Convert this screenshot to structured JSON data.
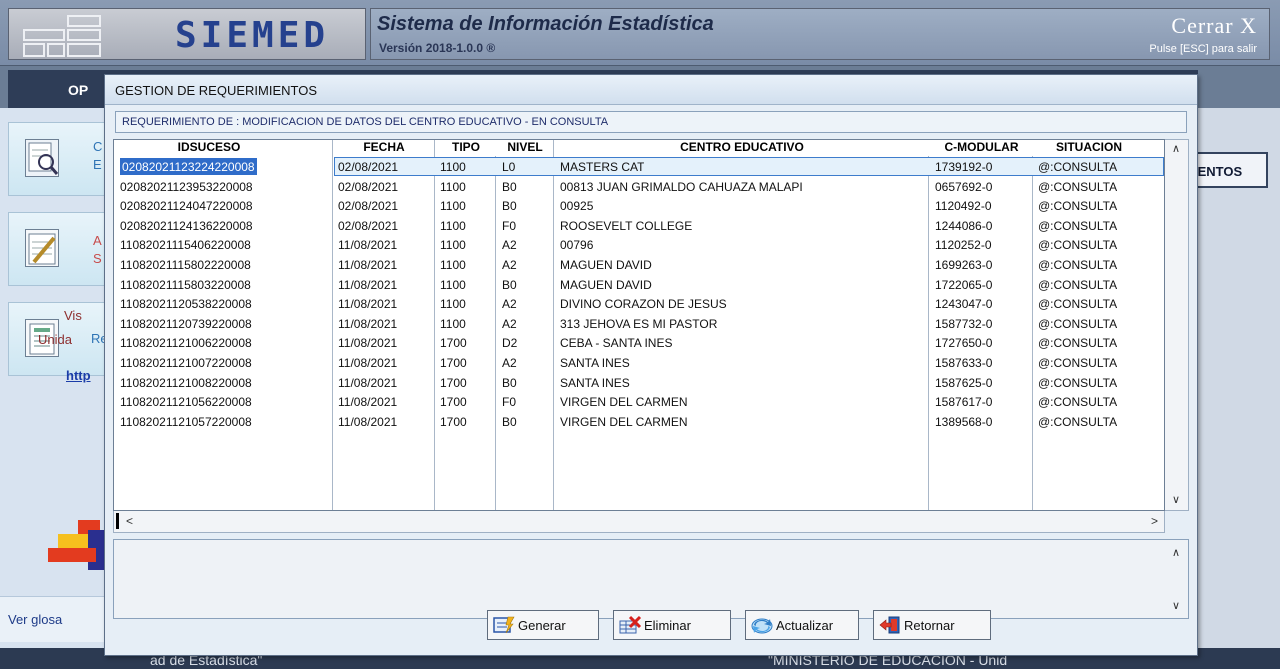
{
  "app": {
    "logo_text": "SIEMED",
    "title": "Sistema de Información Estadística",
    "version": "Versión 2018-1.0.0 ®",
    "close_label": "Cerrar X",
    "close_hint": "Pulse [ESC] para salir",
    "options_label": "OP",
    "right_button_label": "IENTOS",
    "left_menu": [
      {
        "label": "C",
        "label2": "E"
      },
      {
        "label": "A",
        "label2": "S"
      },
      {
        "label": "Re",
        "label2": ""
      }
    ],
    "left_texts": {
      "vis": "Vis",
      "unida": "Unida",
      "http": "http"
    },
    "glosa": "Ver glosa",
    "footer_left": "ad de Estadística\"",
    "footer_right": "\"MINISTERIO DE EDUCACIÓN - Unid"
  },
  "dialog": {
    "title": "GESTION DE REQUERIMIENTOS",
    "requirement": "REQUERIMIENTO DE : MODIFICACION DE DATOS DEL CENTRO EDUCATIVO - EN CONSULTA",
    "columns": [
      "IDSUCESO",
      "FECHA",
      "TIPO",
      "NIVEL",
      "CENTRO EDUCATIVO",
      "C-MODULAR",
      "SITUACION"
    ],
    "rows": [
      [
        "02082021123224220008",
        "02/08/2021",
        "1100",
        "L0",
        "MASTERS CAT",
        "1739192-0",
        "@:CONSULTA"
      ],
      [
        "02082021123953220008",
        "02/08/2021",
        "1100",
        "B0",
        "00813 JUAN GRIMALDO CAHUAZA MALAPI",
        "0657692-0",
        "@:CONSULTA"
      ],
      [
        "02082021124047220008",
        "02/08/2021",
        "1100",
        "B0",
        "00925",
        "1120492-0",
        "@:CONSULTA"
      ],
      [
        "02082021124136220008",
        "02/08/2021",
        "1100",
        "F0",
        "ROOSEVELT COLLEGE",
        "1244086-0",
        "@:CONSULTA"
      ],
      [
        "11082021115406220008",
        "11/08/2021",
        "1100",
        "A2",
        "00796",
        "1120252-0",
        "@:CONSULTA"
      ],
      [
        "11082021115802220008",
        "11/08/2021",
        "1100",
        "A2",
        "MAGUEN DAVID",
        "1699263-0",
        "@:CONSULTA"
      ],
      [
        "11082021115803220008",
        "11/08/2021",
        "1100",
        "B0",
        "MAGUEN DAVID",
        "1722065-0",
        "@:CONSULTA"
      ],
      [
        "11082021120538220008",
        "11/08/2021",
        "1100",
        "A2",
        "DIVINO CORAZON DE JESUS",
        "1243047-0",
        "@:CONSULTA"
      ],
      [
        "11082021120739220008",
        "11/08/2021",
        "1100",
        "A2",
        "313 JEHOVA ES MI PASTOR",
        "1587732-0",
        "@:CONSULTA"
      ],
      [
        "11082021121006220008",
        "11/08/2021",
        "1700",
        "D2",
        "CEBA - SANTA INES",
        "1727650-0",
        "@:CONSULTA"
      ],
      [
        "11082021121007220008",
        "11/08/2021",
        "1700",
        "A2",
        "SANTA INES",
        "1587633-0",
        "@:CONSULTA"
      ],
      [
        "11082021121008220008",
        "11/08/2021",
        "1700",
        "B0",
        "SANTA INES",
        "1587625-0",
        "@:CONSULTA"
      ],
      [
        "11082021121056220008",
        "11/08/2021",
        "1700",
        "F0",
        "VIRGEN DEL CARMEN",
        "1587617-0",
        "@:CONSULTA"
      ],
      [
        "11082021121057220008",
        "11/08/2021",
        "1700",
        "B0",
        "VIRGEN DEL CARMEN",
        "1389568-0",
        "@:CONSULTA"
      ]
    ],
    "selected_row": 0,
    "buttons": {
      "generar": "Generar",
      "eliminar": "Eliminar",
      "actualizar": "Actualizar",
      "retornar": "Retornar"
    },
    "icons": {
      "generar": "generate-doc-icon",
      "eliminar": "delete-table-icon",
      "actualizar": "refresh-icon",
      "retornar": "return-door-icon"
    }
  }
}
